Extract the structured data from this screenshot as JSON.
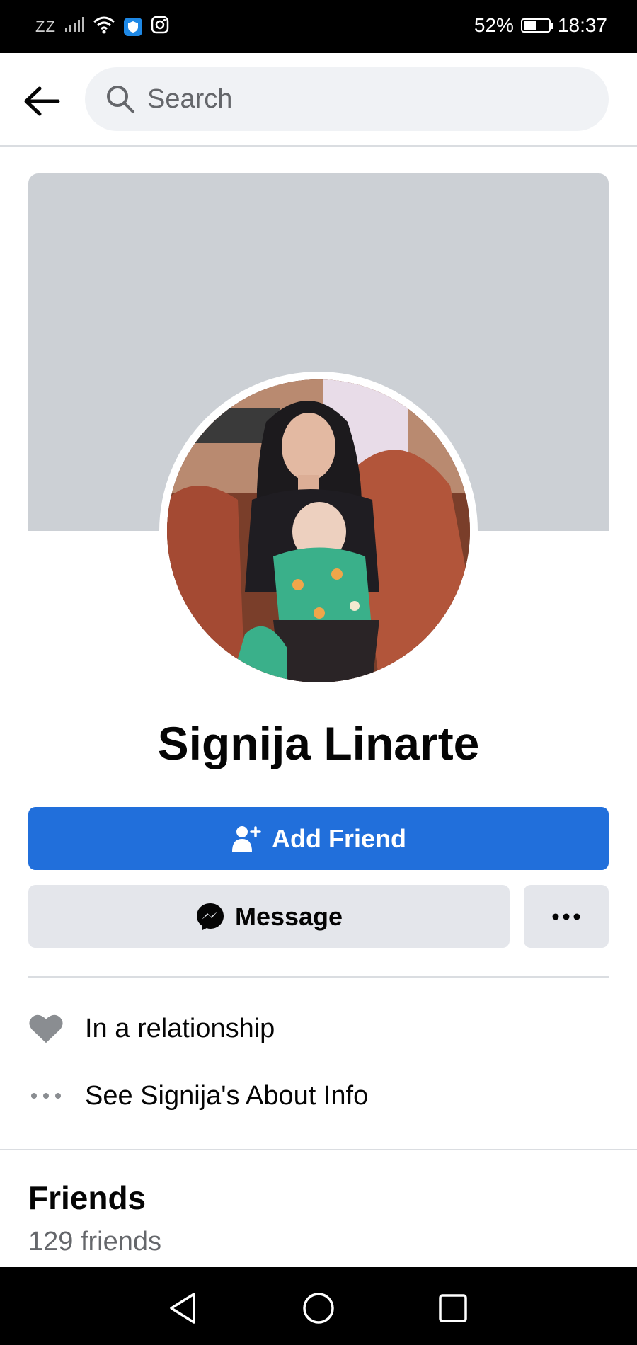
{
  "status_bar": {
    "carrier": "ZZ",
    "battery": "52%",
    "battery_level": 0.52,
    "time": "18:37",
    "icons": [
      "signal-icon",
      "wifi-icon",
      "shield-icon",
      "instagram-icon",
      "battery-icon"
    ]
  },
  "header": {
    "back_icon": "arrow-left-icon",
    "search_placeholder": "Search"
  },
  "profile": {
    "name": "Signija Linarte",
    "add_friend_label": "Add Friend",
    "message_label": "Message",
    "more_icon": "ellipsis-icon"
  },
  "info": {
    "relationship": "In a relationship",
    "about_link": "See Signija's About Info"
  },
  "friends": {
    "title": "Friends",
    "count": "129 friends"
  },
  "colors": {
    "primary": "#216fdb",
    "cover": "#ccd0d5",
    "button_secondary": "#e4e6eb",
    "secondary_text": "#65676b"
  },
  "nav": {
    "icons": [
      "nav-back-icon",
      "nav-home-icon",
      "nav-recent-apps-icon"
    ]
  }
}
